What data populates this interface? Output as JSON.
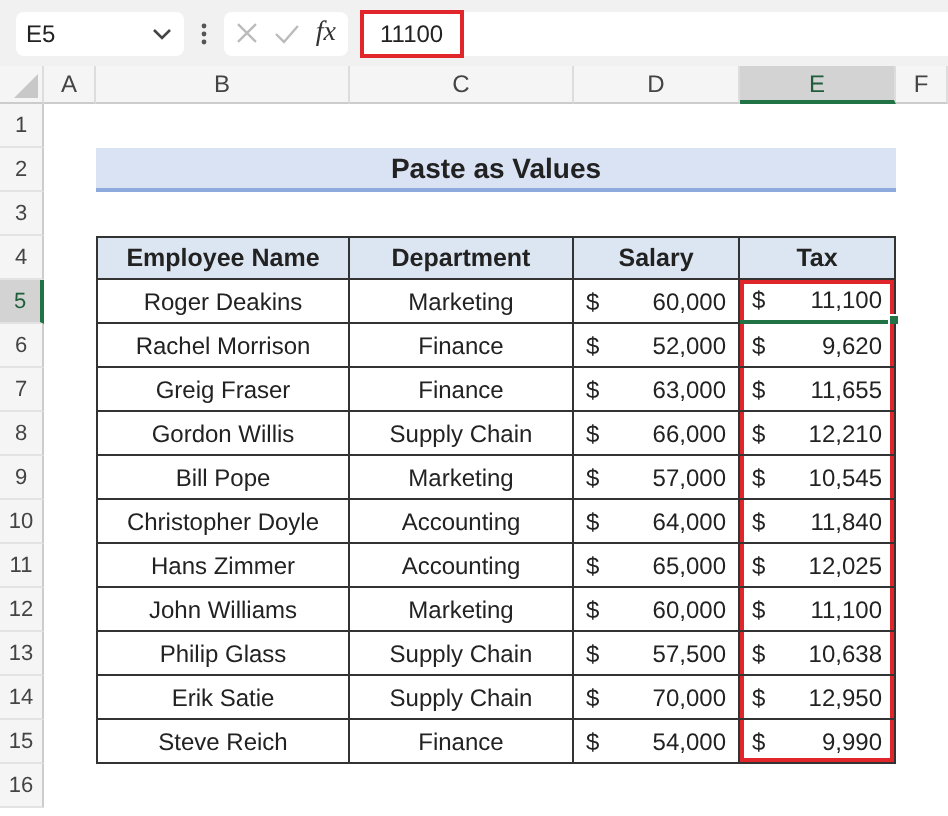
{
  "formula_bar": {
    "name_box": "E5",
    "function_label": "fx",
    "formula": "11100",
    "formula_highlighted": true
  },
  "column_headers": [
    {
      "label": "A",
      "selected": false
    },
    {
      "label": "B",
      "selected": false
    },
    {
      "label": "C",
      "selected": false
    },
    {
      "label": "D",
      "selected": false
    },
    {
      "label": "E",
      "selected": true
    },
    {
      "label": "F",
      "selected": false
    }
  ],
  "row_headers": [
    {
      "label": "1",
      "selected": false
    },
    {
      "label": "2",
      "selected": false
    },
    {
      "label": "3",
      "selected": false
    },
    {
      "label": "4",
      "selected": false
    },
    {
      "label": "5",
      "selected": true
    },
    {
      "label": "6",
      "selected": false
    },
    {
      "label": "7",
      "selected": false
    },
    {
      "label": "8",
      "selected": false
    },
    {
      "label": "9",
      "selected": false
    },
    {
      "label": "10",
      "selected": false
    },
    {
      "label": "11",
      "selected": false
    },
    {
      "label": "12",
      "selected": false
    },
    {
      "label": "13",
      "selected": false
    },
    {
      "label": "14",
      "selected": false
    },
    {
      "label": "15",
      "selected": false
    },
    {
      "label": "16",
      "selected": false
    }
  ],
  "sheet_title": "Paste as Values",
  "table": {
    "columns": [
      {
        "label": "Employee Name",
        "kind": "text",
        "highlighted": false
      },
      {
        "label": "Department",
        "kind": "text",
        "highlighted": false
      },
      {
        "label": "Salary",
        "kind": "currency",
        "highlighted": false
      },
      {
        "label": "Tax",
        "kind": "currency",
        "highlighted": true
      }
    ],
    "rows": [
      {
        "cells": [
          "Roger Deakins",
          "Marketing",
          [
            "$",
            "60,000"
          ],
          [
            "$",
            "11,100"
          ]
        ]
      },
      {
        "cells": [
          "Rachel Morrison",
          "Finance",
          [
            "$",
            "52,000"
          ],
          [
            "$",
            "9,620"
          ]
        ]
      },
      {
        "cells": [
          "Greig Fraser",
          "Finance",
          [
            "$",
            "63,000"
          ],
          [
            "$",
            "11,655"
          ]
        ]
      },
      {
        "cells": [
          "Gordon Willis",
          "Supply Chain",
          [
            "$",
            "66,000"
          ],
          [
            "$",
            "12,210"
          ]
        ]
      },
      {
        "cells": [
          "Bill Pope",
          "Marketing",
          [
            "$",
            "57,000"
          ],
          [
            "$",
            "10,545"
          ]
        ]
      },
      {
        "cells": [
          "Christopher Doyle",
          "Accounting",
          [
            "$",
            "64,000"
          ],
          [
            "$",
            "11,840"
          ]
        ]
      },
      {
        "cells": [
          "Hans Zimmer",
          "Accounting",
          [
            "$",
            "65,000"
          ],
          [
            "$",
            "12,025"
          ]
        ]
      },
      {
        "cells": [
          "John Williams",
          "Marketing",
          [
            "$",
            "60,000"
          ],
          [
            "$",
            "11,100"
          ]
        ]
      },
      {
        "cells": [
          "Philip Glass",
          "Supply Chain",
          [
            "$",
            "57,500"
          ],
          [
            "$",
            "10,638"
          ]
        ]
      },
      {
        "cells": [
          "Erik Satie",
          "Supply Chain",
          [
            "$",
            "70,000"
          ],
          [
            "$",
            "12,950"
          ]
        ]
      },
      {
        "cells": [
          "Steve Reich",
          "Finance",
          [
            "$",
            "54,000"
          ],
          [
            "$",
            "9,990"
          ]
        ]
      }
    ]
  }
}
